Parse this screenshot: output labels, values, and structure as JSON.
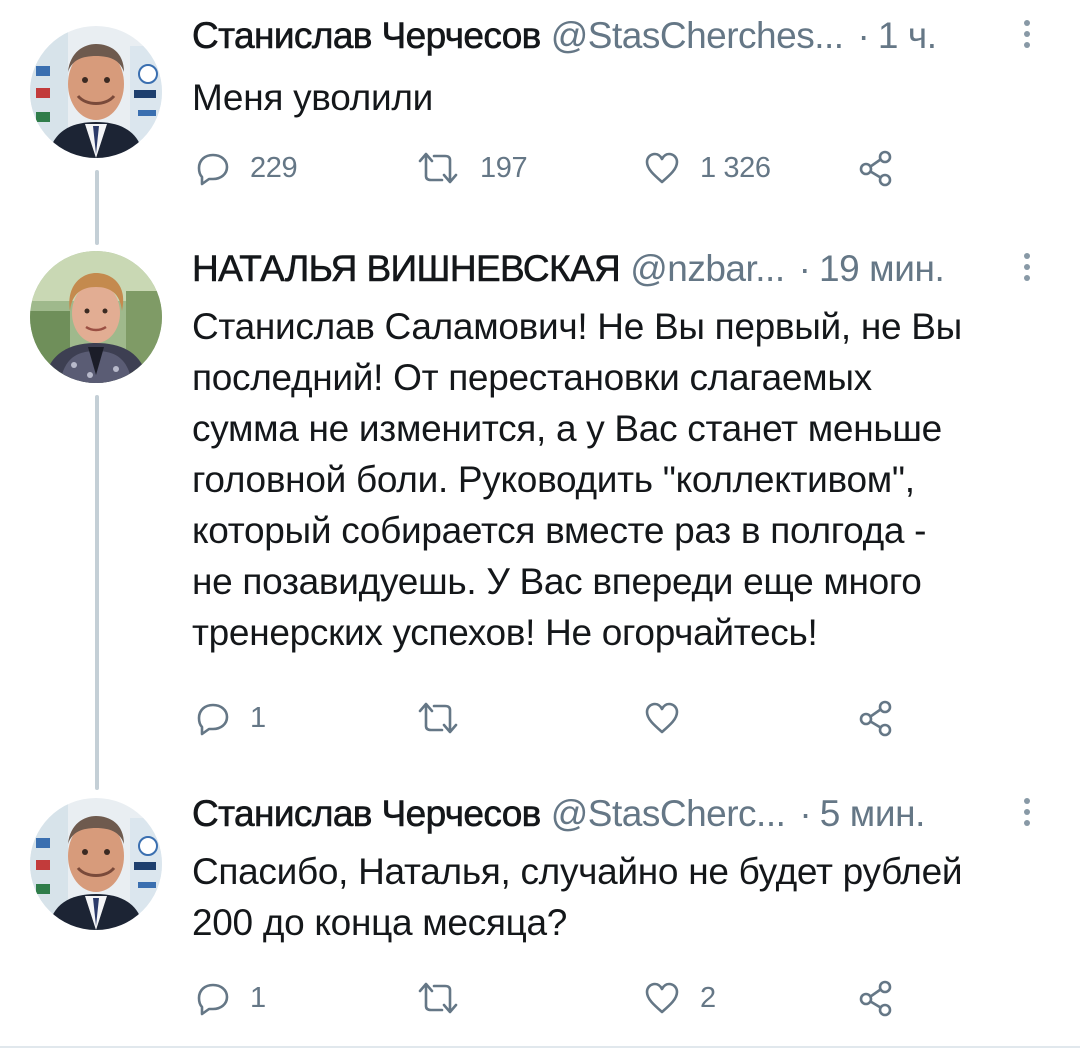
{
  "colors": {
    "text": "#14171a",
    "secondary": "#657786",
    "thread_line": "#c4cfd6",
    "icon": "#657786"
  },
  "tweets": [
    {
      "author_name": "Станислав Черчесов",
      "handle": "@StasCherches...",
      "separator": "·",
      "time": "1 ч.",
      "text": "Меня уволили",
      "avatar_icon": "avatar-man-photo",
      "actions": {
        "reply_count": "229",
        "retweet_count": "197",
        "like_count": "1 326"
      }
    },
    {
      "author_name": "НАТАЛЬЯ ВИШНЕВСКАЯ",
      "handle": "@nzbar...",
      "separator": "·",
      "time": "19 мин.",
      "text": "Станислав Саламович! Не Вы первый, не Вы\nпоследний! От перестановки слагаемых\nсумма не изменится, а у Вас станет меньше\nголовной боли.  Руководить \"коллективом\",\nкоторый собирается вместе раз в полгода -\nне позавидуешь. У Вас впереди еще много\nтренерских успехов! Не огорчайтесь!",
      "avatar_icon": "avatar-woman-photo",
      "actions": {
        "reply_count": "1",
        "retweet_count": "",
        "like_count": ""
      }
    },
    {
      "author_name": "Станислав Черчесов",
      "handle": "@StasCherc...",
      "separator": "·",
      "time": "5 мин.",
      "text": "Спасибо, Наталья, случайно не будет рублей\n200 до конца месяца?",
      "avatar_icon": "avatar-man-photo",
      "actions": {
        "reply_count": "1",
        "retweet_count": "",
        "like_count": "2"
      }
    }
  ]
}
